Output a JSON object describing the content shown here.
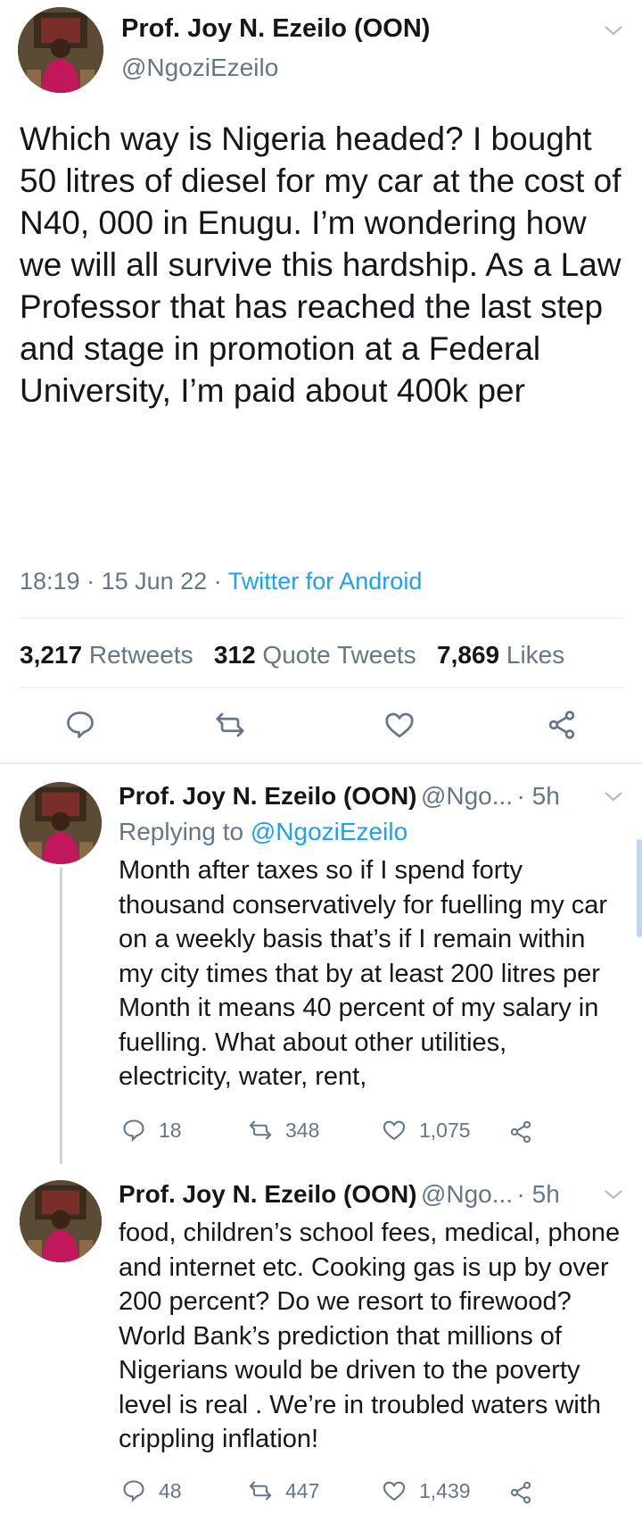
{
  "main_tweet": {
    "author_name": "Prof. Joy N. Ezeilo (OON)",
    "author_handle": "@NgoziEzeilo",
    "text": "Which way is Nigeria headed? I bought 50 litres of diesel for my car at the cost of N40, 000 in Enugu.  I’m wondering how we will all survive this hardship. As a Law Professor that has reached the last step and stage in promotion at a Federal University, I’m paid about 400k per",
    "time": "18:19",
    "date": "15 Jun 22",
    "source": "Twitter for Android",
    "stats": {
      "retweets_count": "3,217",
      "retweets_label": "Retweets",
      "quotes_count": "312",
      "quotes_label": "Quote Tweets",
      "likes_count": "7,869",
      "likes_label": "Likes"
    }
  },
  "replies": [
    {
      "author_name": "Prof. Joy N. Ezeilo (OON)",
      "author_handle": "@Ngo...",
      "age": "· 5h",
      "replying_prefix": "Replying to",
      "replying_to": "@NgoziEzeilo",
      "text": "Month after taxes so if I spend forty thousand conservatively for fuelling my car on a weekly basis that’s if I remain within my city times that by at least 200 litres per Month it means 40 percent of my salary in fuelling. What about other utilities, electricity, water, rent,",
      "replies": "18",
      "retweets": "348",
      "likes": "1,075"
    },
    {
      "author_name": "Prof. Joy N. Ezeilo (OON)",
      "author_handle": "@Ngo...",
      "age": "· 5h",
      "text": "food, children’s school fees, medical, phone and internet  etc. Cooking gas is up by over 200 percent? Do we resort to firewood? World Bank’s prediction that millions of Nigerians would be driven to the poverty level is real . We’re in troubled waters with crippling inflation!",
      "replies": "48",
      "retweets": "447",
      "likes": "1,439"
    }
  ],
  "colors": {
    "accent": "#1da1f2",
    "muted": "#657786",
    "text": "#14171a",
    "divider": "#e6ecf0"
  },
  "icons": [
    "reply-icon",
    "retweet-icon",
    "like-icon",
    "share-icon",
    "chevron-down-icon"
  ]
}
